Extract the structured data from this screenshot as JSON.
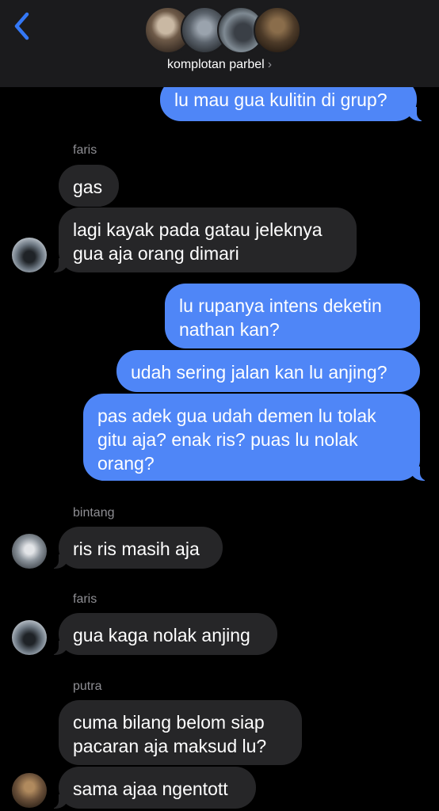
{
  "header": {
    "group_name": "komplotan parbel",
    "chevron": "›",
    "back_icon": "chevron-left-icon",
    "accent": "#3478f6",
    "background": "#1b1b1d"
  },
  "colors": {
    "outgoing_bubble": "#4f86f7",
    "incoming_bubble": "#262628",
    "sender_label": "#8e8e93"
  },
  "messages": [
    {
      "direction": "out",
      "text": "lu mau gua kulitin di grup?"
    },
    {
      "sender": "faris"
    },
    {
      "direction": "in",
      "text": "gas"
    },
    {
      "direction": "in",
      "text": "lagi kayak pada gatau jeleknya\ngua aja orang dimari"
    },
    {
      "direction": "out",
      "text": "lu rupanya intens deketin\nnathan kan?"
    },
    {
      "direction": "out",
      "text": "udah sering jalan kan lu anjing?"
    },
    {
      "direction": "out",
      "text": "pas adek gua udah demen lu tolak\ngitu aja? enak ris? puas lu nolak\norang?"
    },
    {
      "sender": "bintang"
    },
    {
      "direction": "in",
      "text": "ris ris masih aja"
    },
    {
      "sender": "faris"
    },
    {
      "direction": "in",
      "text": "gua kaga nolak anjing"
    },
    {
      "sender": "putra"
    },
    {
      "direction": "in",
      "text": "cuma bilang belom siap\npacaran aja maksud lu?"
    },
    {
      "direction": "in",
      "text": "sama ajaa ngentott"
    }
  ]
}
